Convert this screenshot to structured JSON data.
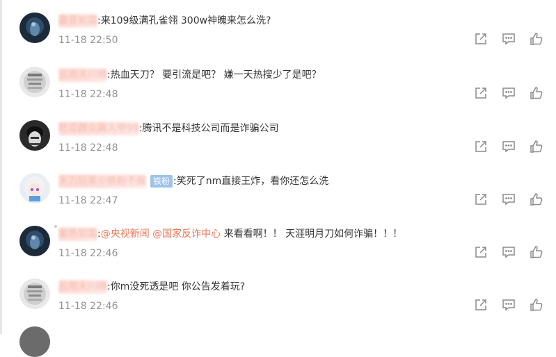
{
  "comments": [
    {
      "username": "嘉音如霜",
      "text": "来109级满孔雀翎 300w神魄来怎么洗?",
      "time": "11-18 22:50"
    },
    {
      "username": "云雨天川晴",
      "text": "热血天刀？ 要引流是吧？ 嫌一天热搜少了是吧？",
      "time": "11-18 22:48"
    },
    {
      "username": "吃瓜群众路人甲99",
      "text": "腾讯不是科技公司而是诈骗公司",
      "time": "11-18 22:48"
    },
    {
      "username": "天刀玩家小铁粉不服",
      "badge": "铁粉",
      "text": "笑死了nm直接王炸，看你还怎么洗",
      "time": "11-18 22:47"
    },
    {
      "username": "紫色如霜",
      "mention1": "@央视新闻",
      "mention2": "@国家反诈中心",
      "text": " 来看看啊！！ 天涯明月刀如何诈骗！！！",
      "time": "11-18 22:46"
    },
    {
      "username": "云雨天川晴",
      "text": "你m没死透是吧 你公告发着玩?",
      "time": "11-18 22:46"
    }
  ],
  "icons": [
    "share-icon",
    "comment-icon",
    "like-icon"
  ],
  "colors": {
    "mention": "#eb7350",
    "badge": "#9ec3ea",
    "time": "#939393",
    "icon": "#8a8a8a"
  }
}
